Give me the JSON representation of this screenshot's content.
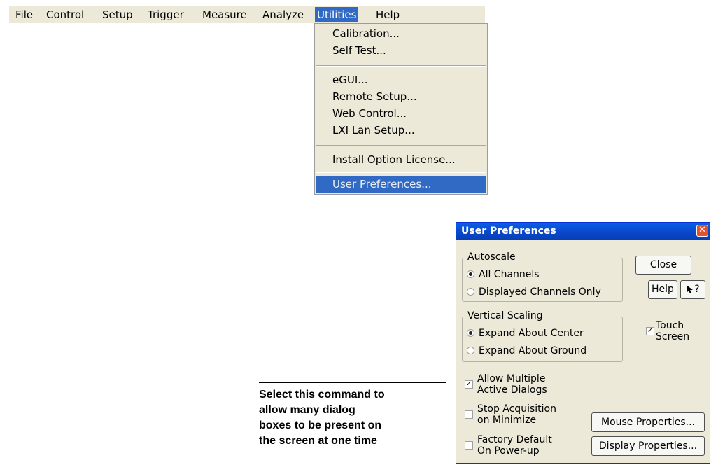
{
  "menubar": {
    "items": [
      "File",
      "Control",
      "Setup",
      "Trigger",
      "Measure",
      "Analyze",
      "Utilities",
      "Help"
    ],
    "active": "Utilities"
  },
  "utilities_menu": {
    "items": [
      "Calibration...",
      "Self Test...",
      "eGUI...",
      "Remote Setup...",
      "Web Control...",
      "LXI Lan Setup...",
      "Install Option License...",
      "User Preferences..."
    ],
    "highlighted": "User Preferences..."
  },
  "dialog": {
    "title": "User Preferences",
    "autoscale": {
      "label": "Autoscale",
      "options": [
        "All Channels",
        "Displayed Channels Only"
      ],
      "selected": "All Channels"
    },
    "vertical_scaling": {
      "label": "Vertical Scaling",
      "options": [
        "Expand About Center",
        "Expand About Ground"
      ],
      "selected": "Expand About Center"
    },
    "buttons": {
      "close": "Close",
      "help": "Help",
      "whats_this": "?",
      "mouse_properties": "Mouse Properties...",
      "display_properties": "Display Properties..."
    },
    "checkboxes": {
      "touch_screen": {
        "label": "Touch\nScreen",
        "checked": true
      },
      "allow_multiple": {
        "label": "Allow Multiple\nActive Dialogs",
        "checked": true
      },
      "stop_acquisition": {
        "label": "Stop Acquisition\non Minimize",
        "checked": false
      },
      "factory_default": {
        "label": "Factory Default\nOn Power-up",
        "checked": false
      }
    },
    "icons": {
      "close": "close-icon",
      "pointer": "arrow-pointer-icon"
    }
  },
  "callout": {
    "text": "Select this command to\nallow many dialog\nboxes to be present on\nthe screen at one time"
  },
  "colors": {
    "menu_highlight": "#316ac5",
    "titlebar": "#0a47c8",
    "dialog_bg": "#ece9d8"
  }
}
